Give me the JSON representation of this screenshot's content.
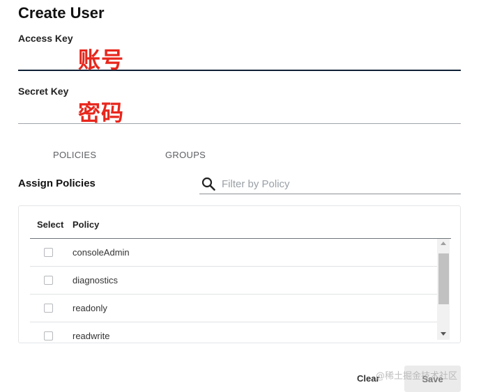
{
  "page": {
    "title": "Create User"
  },
  "access_key": {
    "label": "Access Key",
    "value": "",
    "annotation": "账号"
  },
  "secret_key": {
    "label": "Secret Key",
    "value": "",
    "annotation": "密码"
  },
  "tabs": [
    {
      "label": "POLICIES"
    },
    {
      "label": "GROUPS"
    }
  ],
  "assign": {
    "title": "Assign Policies",
    "filter_placeholder": "Filter by Policy"
  },
  "policy_table": {
    "headers": {
      "select": "Select",
      "policy": "Policy"
    },
    "rows": [
      {
        "name": "consoleAdmin",
        "checked": false
      },
      {
        "name": "diagnostics",
        "checked": false
      },
      {
        "name": "readonly",
        "checked": false
      },
      {
        "name": "readwrite",
        "checked": false
      }
    ]
  },
  "actions": {
    "clear_label": "Clear",
    "save_label": "Save"
  },
  "watermark": "@稀土掘金技术社区",
  "colors": {
    "annotation_red": "#e8261c",
    "active_underline": "#0f1f35",
    "save_button_bg": "#ebebeb"
  }
}
